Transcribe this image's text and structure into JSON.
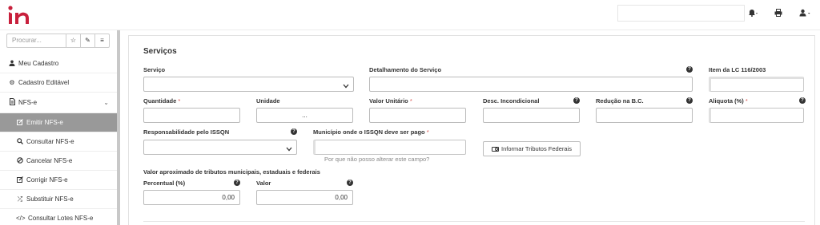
{
  "brand": {
    "color": "#c8203c",
    "logo_text": "in"
  },
  "topbar": {
    "bell_icon": "bell-icon",
    "print_icon": "print-icon",
    "user_icon": "user-icon"
  },
  "sidebar": {
    "search_placeholder": "Procurar...",
    "items": [
      {
        "label": "Meu Cadastro",
        "icon": "user-icon"
      },
      {
        "label": "Cadastro Editável",
        "icon": "cogs-icon"
      },
      {
        "label": "NFS-e",
        "icon": "document-icon"
      },
      {
        "label": "Emitir NFS-e",
        "icon": "edit-icon",
        "active": true
      },
      {
        "label": "Consultar NFS-e",
        "icon": "search-icon"
      },
      {
        "label": "Cancelar NFS-e",
        "icon": "ban-icon"
      },
      {
        "label": "Corrigir NFS-e",
        "icon": "pencil-square-icon"
      },
      {
        "label": "Substituir NFS-e",
        "icon": "shuffle-icon"
      },
      {
        "label": "Consultar Lotes NFS-e",
        "icon": "code-icon"
      }
    ]
  },
  "panel": {
    "title": "Serviços",
    "fields": {
      "servico": {
        "label": "Serviço",
        "value": ""
      },
      "detalhamento": {
        "label": "Detalhamento do Serviço",
        "value": ""
      },
      "item_lc": {
        "label": "Item da LC 116/2003",
        "value": ""
      },
      "quantidade": {
        "label": "Quantidade",
        "required": "*",
        "value": ""
      },
      "unidade": {
        "label": "Unidade",
        "value": "..."
      },
      "valor_unitario": {
        "label": "Valor Unitário",
        "required": "*",
        "value": ""
      },
      "desc_incondicional": {
        "label": "Desc. Incondicional",
        "value": ""
      },
      "reducao_bc": {
        "label": "Redução na B.C.",
        "value": ""
      },
      "aliquota": {
        "label": "Aliquota (%)",
        "required": "*",
        "value": ""
      },
      "responsabilidade": {
        "label": "Responsabilidade pelo ISSQN",
        "value": ""
      },
      "municipio": {
        "label": "Município onde o ISSQN deve ser pago",
        "required": "*",
        "value": "",
        "hint": "Por que não posso alterar este campo?"
      },
      "percentual": {
        "label": "Percentual (%)",
        "value": "0,00"
      },
      "valor": {
        "label": "Valor",
        "value": "0,00"
      }
    },
    "tributos_button": "Informar Tributos Federais",
    "aprox_label": "Valor aproximado de tributos municipais, estaduais e federais"
  }
}
